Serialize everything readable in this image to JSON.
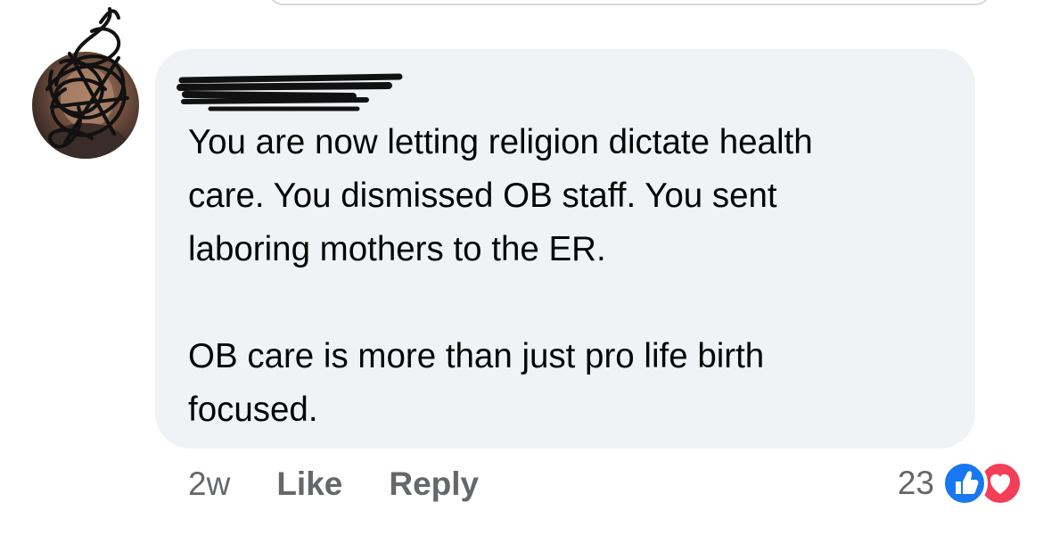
{
  "comment": {
    "text": "You are now letting religion dictate health\ncare. You dismissed OB staff. You sent\nlaboring mothers to the ER.\n\nOB care is more than just pro life birth\nfocused."
  },
  "actions": {
    "timestamp": "2w",
    "like_label": "Like",
    "reply_label": "Reply"
  },
  "reactions": {
    "count": "23",
    "icons": [
      "like-icon",
      "love-icon"
    ]
  },
  "colors": {
    "bubble_bg": "#f0f2f5",
    "meta_text": "#65676b",
    "like_blue": "#1877f2",
    "love_red": "#f33e58"
  }
}
